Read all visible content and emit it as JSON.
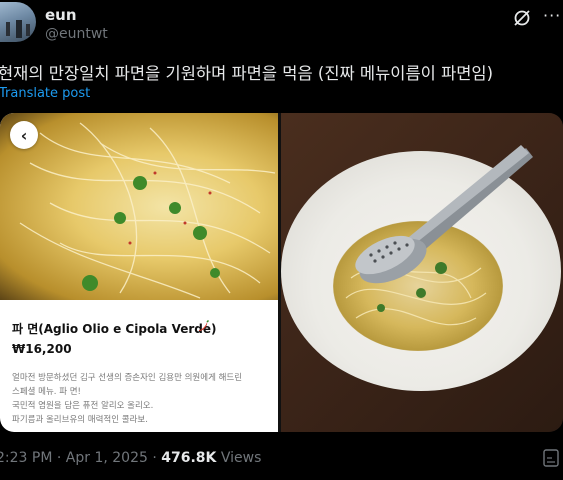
{
  "author": {
    "name": "eun",
    "handle": "@euntwt"
  },
  "post": {
    "text": "현재의 만장일치 파면을 기원하며 파면을 먹음 (진짜 메뉴이름이 파면임)",
    "translate_label": "Translate post"
  },
  "menu_card": {
    "name": "파 면(Aglio Olio e Cipola Verde)",
    "price": "₩16,200",
    "description": [
      "얼마전 방문하셨던 김구 선생의 증손자인 김용만 의원에게 해드린",
      "스페셜 메뉴. 파 면!",
      "국민적 염원을 담은 퓨전 알리오 올리오.",
      "파기름과 올리브유의 매력적인 콜라보."
    ]
  },
  "meta": {
    "time": "2:23 PM",
    "date": "Apr 1, 2025",
    "views_count": "476.8K",
    "views_label": "Views"
  },
  "icons": {
    "grok": "grok-icon",
    "more": "more-icon",
    "back": "chevron-left-icon",
    "pepper": "chili-pepper-icon",
    "bookmark": "bookmark-icon"
  }
}
